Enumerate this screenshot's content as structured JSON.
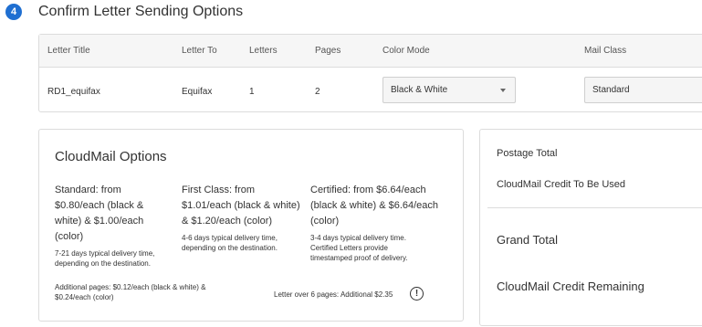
{
  "step": {
    "number": "4",
    "title": "Confirm Letter Sending Options"
  },
  "letters_table": {
    "headers": {
      "letter_title": "Letter Title",
      "letter_to": "Letter To",
      "letters": "Letters",
      "pages": "Pages",
      "color_mode": "Color Mode",
      "mail_class": "Mail Class"
    },
    "rows": [
      {
        "letter_title": "RD1_equifax",
        "letter_to": "Equifax",
        "letters": "1",
        "pages": "2",
        "color_mode": "Black & White",
        "mail_class": "Standard"
      }
    ]
  },
  "cloudmail_options": {
    "title": "CloudMail Options",
    "standard": {
      "price": "Standard: from $0.80/each (black & white) & $1.00/each (color)",
      "note": "7-21 days typical delivery time, depending on the destination."
    },
    "first_class": {
      "price": "First Class: from $1.01/each (black & white) & $1.20/each (color)",
      "note": "4-6 days typical delivery time, depending on the destination."
    },
    "certified": {
      "price": "Certified: from $6.64/each (black & white) & $6.64/each (color)",
      "note": "3-4 days typical delivery time. Certified Letters provide timestamped proof of delivery."
    },
    "additional_pages": "Additional pages: $0.12/each (black & white) & $0.24/each (color)",
    "over_six_pages": "Letter over 6 pages: Additional $2.35",
    "warning_icon": "!"
  },
  "totals": {
    "postage_total": "Postage Total",
    "credit_used": "CloudMail Credit To Be Used",
    "grand_total": "Grand Total",
    "credit_remaining": "CloudMail Credit Remaining"
  },
  "colors": {
    "accent": "#1f6fd1",
    "border": "#dcdcdc",
    "text": "#333333"
  }
}
